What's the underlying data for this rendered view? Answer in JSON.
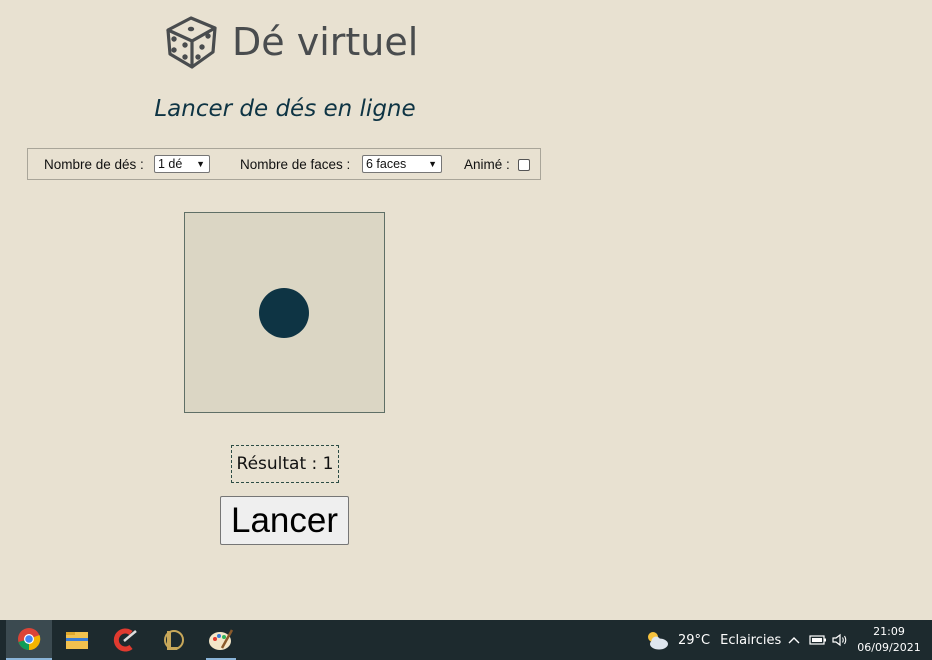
{
  "header": {
    "title": "Dé virtuel",
    "subtitle": "Lancer de dés en ligne",
    "logo_icon": "dice-icon"
  },
  "options": {
    "dice_count_label": "Nombre de dés :",
    "dice_count_value": "1 dé",
    "faces_label": "Nombre de faces :",
    "faces_value": "6 faces",
    "animated_label": "Animé :",
    "animated_checked": false
  },
  "die": {
    "face_value": 1,
    "pip_color": "#0e3444",
    "face_color": "#dbd6c4"
  },
  "result": {
    "text": "Résultat : 1"
  },
  "roll_button": {
    "label": "Lancer"
  },
  "taskbar": {
    "apps": [
      "chrome-icon",
      "file-explorer-icon",
      "ccleaner-icon",
      "league-of-legends-icon",
      "paint-icon"
    ],
    "weather": {
      "icon": "partly-cloudy-icon",
      "temperature": "29°C",
      "description": "Eclaircies"
    },
    "tray_icons": [
      "chevron-up-icon",
      "battery-icon",
      "volume-icon"
    ],
    "clock": {
      "time": "21:09",
      "date": "06/09/2021"
    }
  },
  "colors": {
    "background": "#e8e1d1",
    "accent": "#0e3444",
    "taskbar": "#1d2a2e"
  }
}
